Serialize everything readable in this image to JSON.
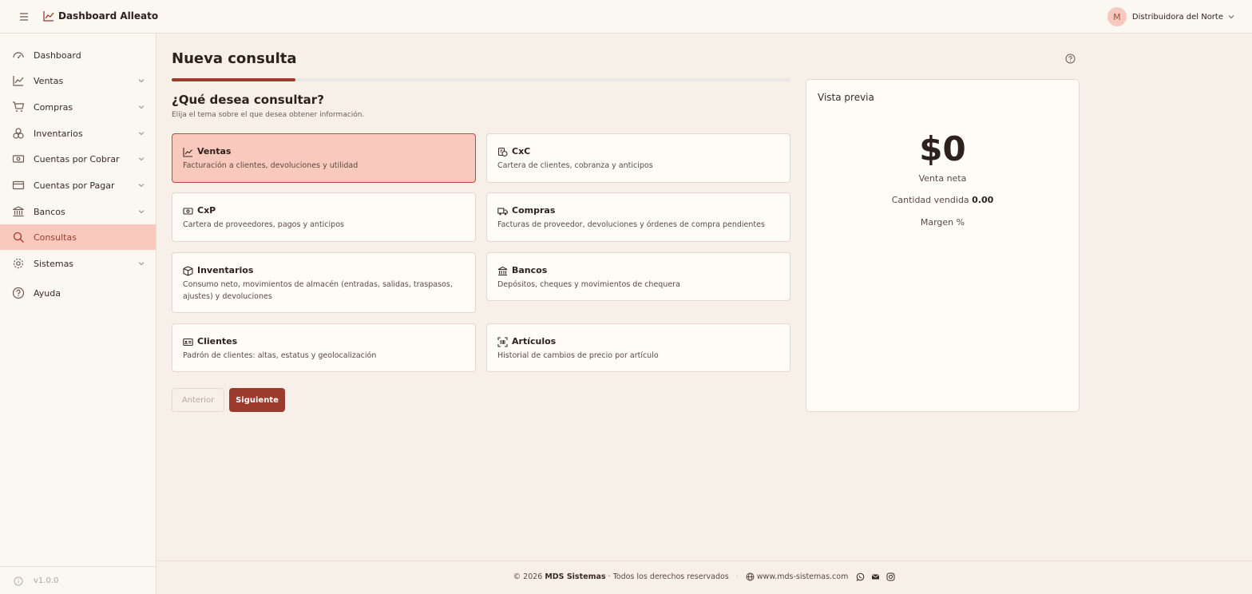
{
  "header": {
    "app_title": "Dashboard Alleato",
    "user_initial": "M",
    "user_name": "Distribuidora del Norte"
  },
  "sidebar": {
    "items": [
      {
        "label": "Dashboard",
        "icon": "gauge-icon",
        "has_submenu": false
      },
      {
        "label": "Ventas",
        "icon": "trending-up-icon",
        "has_submenu": true
      },
      {
        "label": "Compras",
        "icon": "cart-icon",
        "has_submenu": true
      },
      {
        "label": "Inventarios",
        "icon": "boxes-icon",
        "has_submenu": true
      },
      {
        "label": "Cuentas por Cobrar",
        "icon": "money-icon",
        "has_submenu": true
      },
      {
        "label": "Cuentas por Pagar",
        "icon": "credit-card-icon",
        "has_submenu": true
      },
      {
        "label": "Bancos",
        "icon": "bank-icon",
        "has_submenu": true
      },
      {
        "label": "Consultas",
        "icon": "search-icon",
        "has_submenu": false,
        "active": true
      },
      {
        "label": "Sistemas",
        "icon": "gear-icon",
        "has_submenu": true
      },
      {
        "label": "Ayuda",
        "icon": "help-circle-icon",
        "has_submenu": false
      }
    ],
    "version": "v1.0.0"
  },
  "main": {
    "title": "Nueva consulta",
    "progress_fraction": 0.2,
    "question": "¿Qué desea consultar?",
    "question_sub": "Elija el tema sobre el que desea obtener información.",
    "cards": [
      {
        "title": "Ventas",
        "desc": "Facturación a clientes, devoluciones y utilidad",
        "icon": "trending-up-icon",
        "selected": true
      },
      {
        "title": "CxC",
        "desc": "Cartera de clientes, cobranza y anticipos",
        "icon": "receipt-icon"
      },
      {
        "title": "CxP",
        "desc": "Cartera de proveedores, pagos y anticipos",
        "icon": "money-icon"
      },
      {
        "title": "Compras",
        "desc": "Facturas de proveedor, devoluciones y órdenes de compra pendientes",
        "icon": "truck-icon"
      },
      {
        "title": "Inventarios",
        "desc": "Consumo neto, movimientos de almacén (entradas, salidas, traspasos, ajustes) y devoluciones",
        "icon": "package-icon"
      },
      {
        "title": "Bancos",
        "desc": "Depósitos, cheques y movimientos de chequera",
        "icon": "bank-icon"
      },
      {
        "title": "Clientes",
        "desc": "Padrón de clientes: altas, estatus y geolocalización",
        "icon": "id-card-icon"
      },
      {
        "title": "Artículos",
        "desc": "Historial de cambios de precio por artículo",
        "icon": "barcode-scan-icon"
      }
    ],
    "prev_label": "Anterior",
    "next_label": "Siguiente"
  },
  "preview": {
    "title": "Vista previa",
    "value": "$0",
    "value_label": "Venta neta",
    "qty_label": "Cantidad vendida",
    "qty_value": "0.00",
    "margin_label": "Margen %"
  },
  "footer": {
    "copyright_prefix": "© 2026",
    "brand": "MDS Sistemas",
    "copyright_suffix": "· Todos los derechos reservados",
    "separator": "·",
    "website": "www.mds-sistemas.com"
  },
  "colors": {
    "accent": "#9b3b2d",
    "selected_bg": "#f9c9bd",
    "page_bg": "#f7f0e8"
  }
}
